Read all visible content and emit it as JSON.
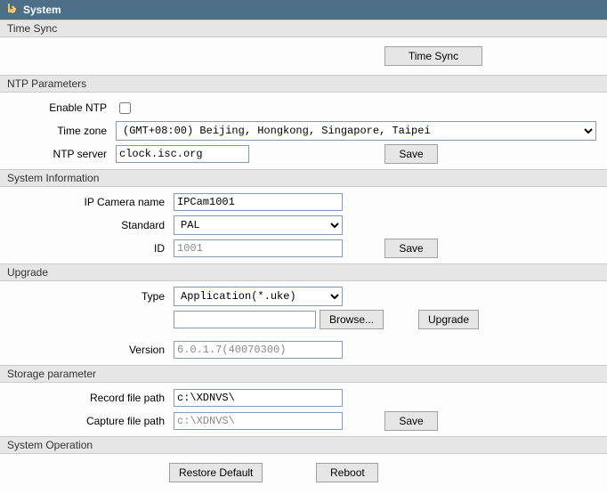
{
  "header": {
    "title": "System"
  },
  "timesync": {
    "section": "Time Sync",
    "button": "Time Sync"
  },
  "ntp": {
    "section": "NTP Parameters",
    "enable_label": "Enable NTP",
    "timezone_label": "Time zone",
    "timezone_value": "(GMT+08:00) Beijing, Hongkong, Singapore, Taipei",
    "server_label": "NTP server",
    "server_value": "clock.isc.org",
    "save": "Save"
  },
  "sysinfo": {
    "section": "System Information",
    "name_label": "IP Camera name",
    "name_value": "IPCam1001",
    "standard_label": "Standard",
    "standard_value": "PAL",
    "id_label": "ID",
    "id_value": "1001",
    "save": "Save"
  },
  "upgrade": {
    "section": "Upgrade",
    "type_label": "Type",
    "type_value": "Application(*.uke)",
    "browse": "Browse...",
    "upgrade_btn": "Upgrade",
    "version_label": "Version",
    "version_value": "6.0.1.7(40070300)"
  },
  "storage": {
    "section": "Storage parameter",
    "record_label": "Record file path",
    "record_value": "c:\\XDNVS\\",
    "capture_label": "Capture file path",
    "capture_value": "c:\\XDNVS\\",
    "save": "Save"
  },
  "sysop": {
    "section": "System Operation",
    "restore": "Restore Default",
    "reboot": "Reboot"
  }
}
